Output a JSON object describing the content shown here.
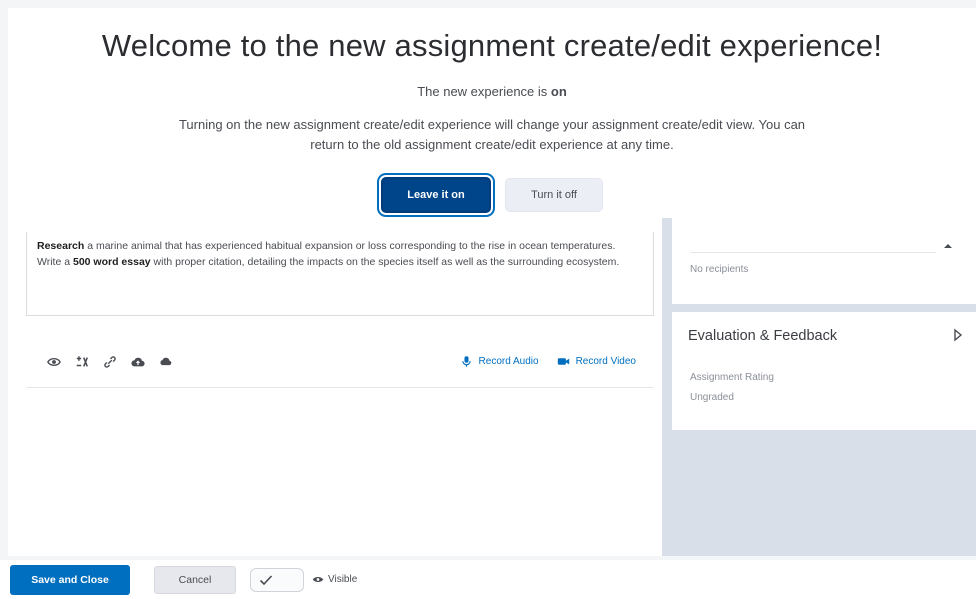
{
  "banner": {
    "title": "Welcome to the new assignment create/edit experience!",
    "status_prefix": "The new experience is ",
    "status_value": "on",
    "description": "Turning on the new assignment create/edit experience will change your assignment create/edit view. You can return to the old assignment create/edit experience at any time.",
    "leave_on_label": "Leave it on",
    "turn_off_label": "Turn it off"
  },
  "instructions": {
    "part1_bold": "Research",
    "part2": " a marine animal that has experienced habitual expansion or loss corresponding to the rise in ocean temperatures. Write a ",
    "part3_bold": "500 word essay",
    "part4": " with proper citation, detailing the impacts on the species itself as well as the surrounding ecosystem."
  },
  "toolbar": {
    "tools": [
      "eye-icon",
      "equation-icon",
      "link-icon",
      "upload-icon",
      "cloud-icon"
    ],
    "record_audio_label": "Record Audio",
    "record_video_label": "Record Video"
  },
  "sidebar": {
    "top_card_hint": "No recipients",
    "evaluation_title": "Evaluation & Feedback",
    "assignment_rating_label": "Assignment Rating",
    "assignment_rating_value": "Ungraded"
  },
  "footer": {
    "save_close_label": "Save and Close",
    "cancel_label": "Cancel",
    "visible_label": "Visible"
  },
  "colors": {
    "primary": "#006fbf",
    "primary_dark": "#004489",
    "sidebar_bg": "#d9dfe9"
  }
}
